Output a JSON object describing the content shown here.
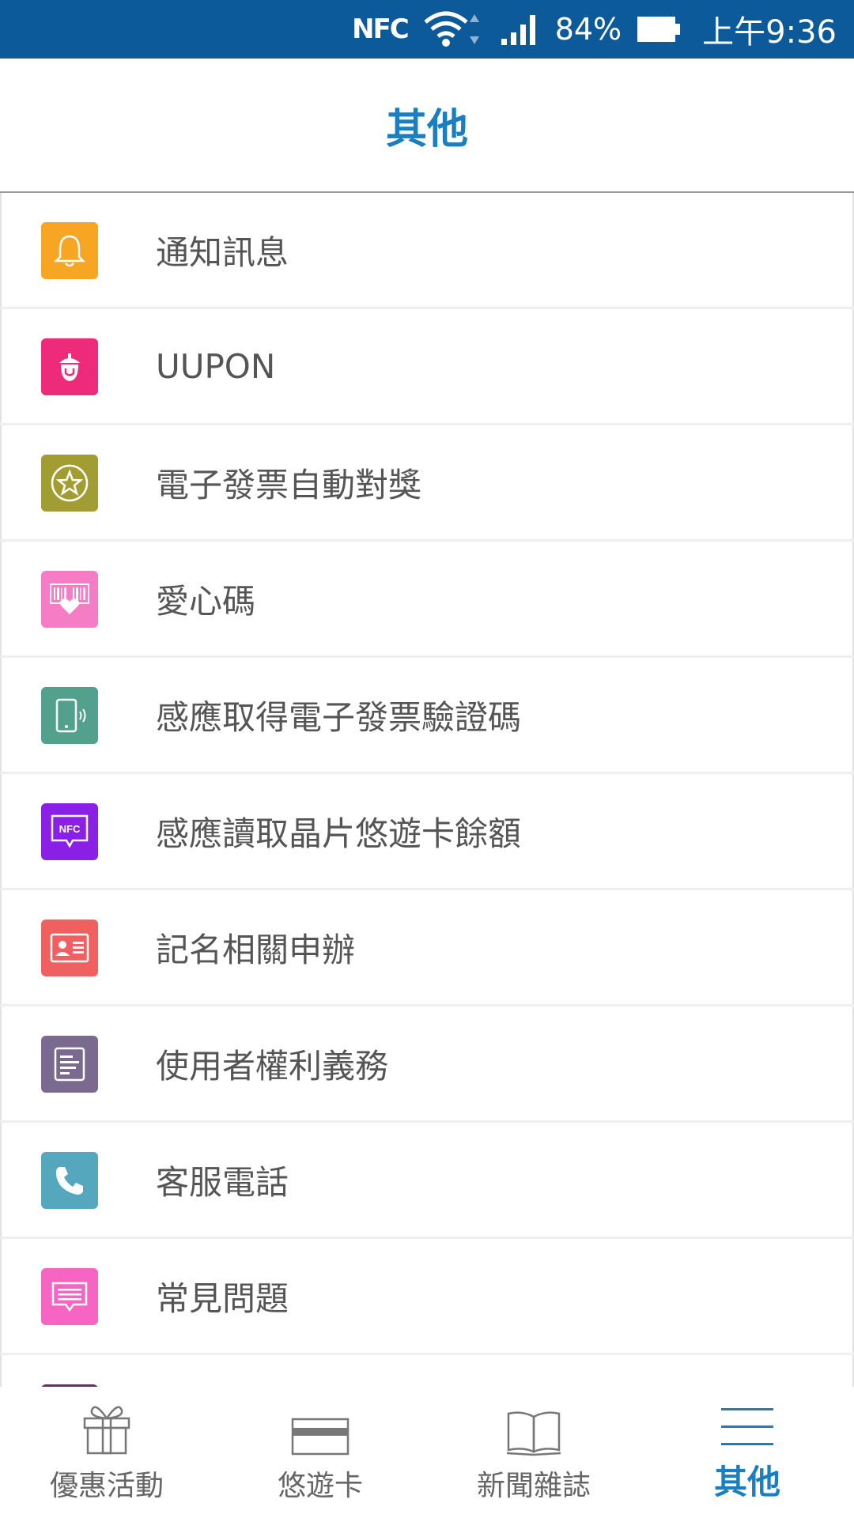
{
  "status_bar": {
    "nfc_label": "NFC",
    "battery_percent": "84%",
    "time": "上午9:36",
    "background": "#0d5a9a"
  },
  "header": {
    "title": "其他"
  },
  "menu": {
    "items": [
      {
        "label": "通知訊息",
        "icon": "bell-icon",
        "color": "#f6a623"
      },
      {
        "label": "UUPON",
        "icon": "acorn-icon",
        "color": "#ee2a7b"
      },
      {
        "label": "電子發票自動對獎",
        "icon": "star-medal-icon",
        "color": "#a29d32"
      },
      {
        "label": "愛心碼",
        "icon": "barcode-heart-icon",
        "color": "#f77cc6"
      },
      {
        "label": "感應取得電子發票驗證碼",
        "icon": "phone-tap-icon",
        "color": "#53a08c"
      },
      {
        "label": "感應讀取晶片悠遊卡餘額",
        "icon": "nfc-chat-icon",
        "color": "#8a1fe6",
        "icon_text": "NFC"
      },
      {
        "label": "記名相關申辦",
        "icon": "id-card-icon",
        "color": "#f16060"
      },
      {
        "label": "使用者權利義務",
        "icon": "document-icon",
        "color": "#7b6a8f"
      },
      {
        "label": "客服電話",
        "icon": "phone-icon",
        "color": "#55a7be"
      },
      {
        "label": "常見問題",
        "icon": "message-icon",
        "color": "#f565c1"
      }
    ]
  },
  "tabs": [
    {
      "label": "優惠活動",
      "icon": "gift-icon",
      "active": false
    },
    {
      "label": "悠遊卡",
      "icon": "card-icon",
      "active": false
    },
    {
      "label": "新聞雜誌",
      "icon": "book-icon",
      "active": false
    },
    {
      "label": "其他",
      "icon": "menu-icon",
      "active": true
    }
  ],
  "colors": {
    "accent": "#1a7fc0",
    "text": "#555555"
  }
}
